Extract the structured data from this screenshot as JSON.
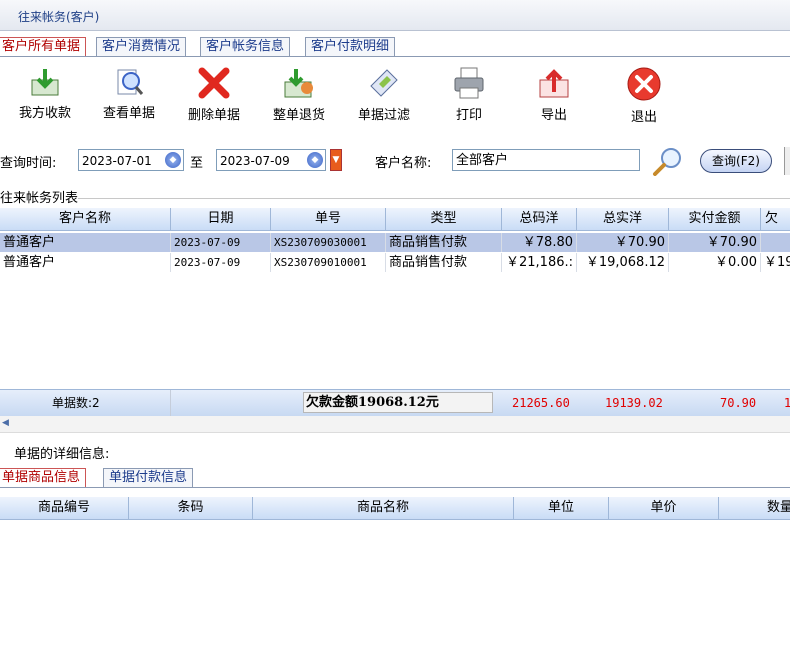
{
  "window": {
    "title": "往来帐务(客户)"
  },
  "top_tabs": [
    {
      "label": "客户所有单据"
    },
    {
      "label": "客户消费情况"
    },
    {
      "label": "客户帐务信息"
    },
    {
      "label": "客户付款明细"
    }
  ],
  "toolbar": {
    "receive": "我方收款",
    "view": "查看单据",
    "delete": "删除单据",
    "return": "整单退货",
    "filter": "单据过滤",
    "print": "打印",
    "export": "导出",
    "exit": "退出"
  },
  "query": {
    "time_label": "查询时间:",
    "from": "2023-07-01",
    "to_label": "至",
    "to": "2023-07-09",
    "customer_label": "客户名称:",
    "customer": "全部客户",
    "search_button": "查询(F2)"
  },
  "list": {
    "title": "往来帐务列表",
    "headers": [
      "客户名称",
      "日期",
      "单号",
      "类型",
      "总码洋",
      "总实洋",
      "实付金额",
      "欠"
    ],
    "rows": [
      [
        "普通客户",
        "2023-07-09",
        "XS230709030001",
        "商品销售付款",
        "￥78.80",
        "￥70.90",
        "￥70.90",
        ""
      ],
      [
        "普通客户",
        "2023-07-09",
        "XS230709010001",
        "商品销售付款",
        "￥21,186.:",
        "￥19,068.12",
        "￥0.00",
        "￥19"
      ]
    ]
  },
  "summary": {
    "count": "单据数:2",
    "debt": "欠款金额19068.12元",
    "total_list": "21265.60",
    "total_actual": "19139.02",
    "paid": "70.90",
    "owed": "1"
  },
  "detail": {
    "title": "单据的详细信息:",
    "tabs": [
      {
        "label": "单据商品信息"
      },
      {
        "label": "单据付款信息"
      }
    ],
    "headers": [
      "商品编号",
      "条码",
      "商品名称",
      "单位",
      "单价",
      "数量"
    ]
  },
  "colors": {
    "selected_row": "#b9c7e6",
    "red": "#e00000",
    "accent": "#1d3c8c"
  }
}
